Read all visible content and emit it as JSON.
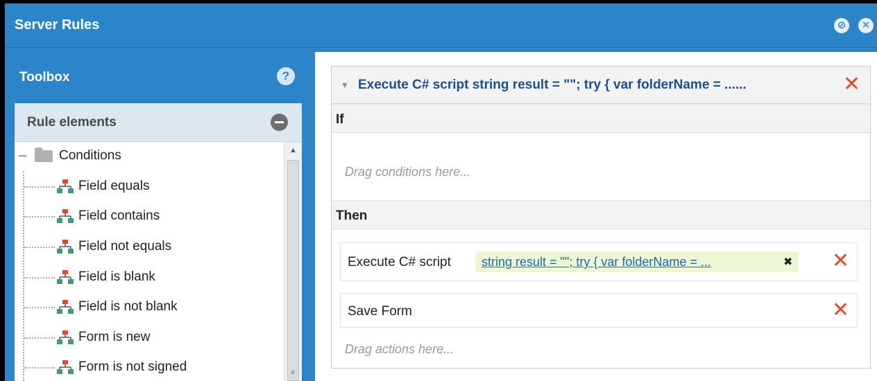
{
  "window": {
    "title": "Server Rules"
  },
  "toolbox": {
    "title": "Toolbox",
    "help_glyph": "?",
    "section": {
      "label": "Rule elements"
    },
    "tree": {
      "folder": "Conditions",
      "items": [
        "Field equals",
        "Field contains",
        "Field not equals",
        "Field is blank",
        "Field is not blank",
        "Form is new",
        "Form is not signed"
      ]
    }
  },
  "rule": {
    "title": "Execute C# script string result = \"\"; try { var folderName = ......",
    "if_label": "If",
    "conditions_hint": "Drag conditions here...",
    "then_label": "Then",
    "actions": [
      {
        "label": "Execute C# script",
        "param": "string result = \"\"; try { var folderName = ..."
      },
      {
        "label": "Save Form"
      }
    ],
    "actions_hint": "Drag actions here..."
  },
  "colors": {
    "brand": "#2d85c9",
    "remove": "#e2492a",
    "link": "#2467a9",
    "param_bg": "#eef7d3"
  },
  "icons": {
    "window_minimize": "minimize-icon",
    "window_close": "close-icon",
    "help": "help-icon",
    "collapse": "collapse-icon",
    "folder": "folder-icon",
    "rule_item": "hierarchy-icon",
    "remove": "x-icon"
  }
}
